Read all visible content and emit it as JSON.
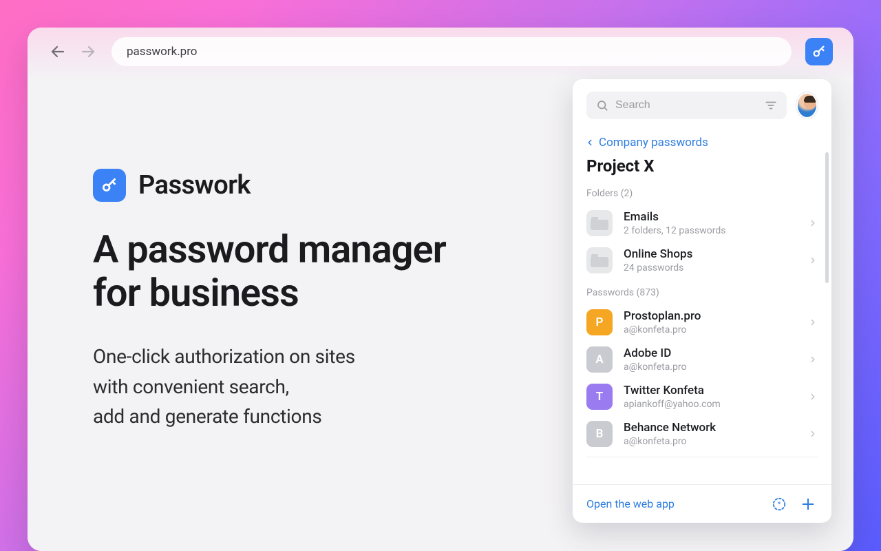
{
  "browser": {
    "url": "passwork.pro"
  },
  "hero": {
    "brand": "Passwork",
    "headline_l1": "A password manager",
    "headline_l2": "for business",
    "sub_l1": "One-click authorization on sites",
    "sub_l2": "with convenient search,",
    "sub_l3": "add and generate functions"
  },
  "panel": {
    "search_placeholder": "Search",
    "breadcrumb": "Company passwords",
    "title": "Project X",
    "folders_label": "Folders (2)",
    "passwords_label": "Passwords (873)",
    "folders": [
      {
        "name": "Emails",
        "detail": "2 folders, 12 passwords"
      },
      {
        "name": "Online Shops",
        "detail": "24 passwords"
      }
    ],
    "passwords": [
      {
        "letter": "P",
        "color": "#f5a623",
        "name": "Prostoplan.pro",
        "detail": "a@konfeta.pro"
      },
      {
        "letter": "A",
        "color": "#c9cbd0",
        "name": "Adobe ID",
        "detail": "a@konfeta.pro"
      },
      {
        "letter": "T",
        "color": "#9b7bf0",
        "name": "Twitter Konfeta",
        "detail": "apiankoff@yahoo.com"
      },
      {
        "letter": "B",
        "color": "#c9cbd0",
        "name": "Behance Network",
        "detail": "a@konfeta.pro"
      }
    ],
    "open_link": "Open the web app"
  }
}
